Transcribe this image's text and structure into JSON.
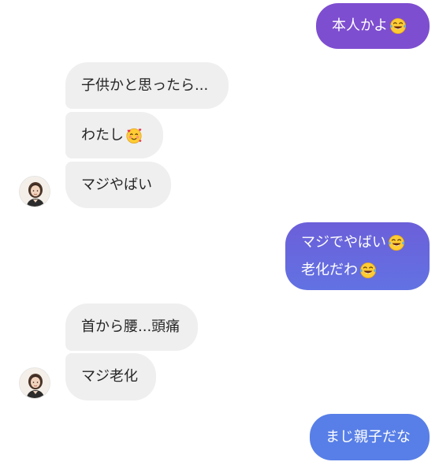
{
  "colors": {
    "outgoing_top": "#7d4fcf",
    "outgoing_mid": "#6f5fda",
    "outgoing_bottom": "#5b7ee6",
    "incoming_bg": "#efefef",
    "incoming_text": "#262626"
  },
  "messages": {
    "out1": {
      "text": "本人かよ",
      "emoji": "face-with-tears-of-joy-icon"
    },
    "in_group1": [
      {
        "text": "子供かと思ったら..."
      },
      {
        "text": "わたし",
        "emoji": "smiling-face-with-hearts-icon"
      },
      {
        "text": "マジやばい"
      }
    ],
    "out2": {
      "line1": "マジでやばい",
      "line1_emoji": "face-with-tears-of-joy-icon",
      "line2": "老化だわ",
      "line2_emoji": "face-with-tears-of-joy-icon"
    },
    "in_group2": [
      {
        "text": "首から腰...頭痛"
      },
      {
        "text": "マジ老化"
      }
    ],
    "out3": {
      "text": "まじ親子だな"
    }
  }
}
